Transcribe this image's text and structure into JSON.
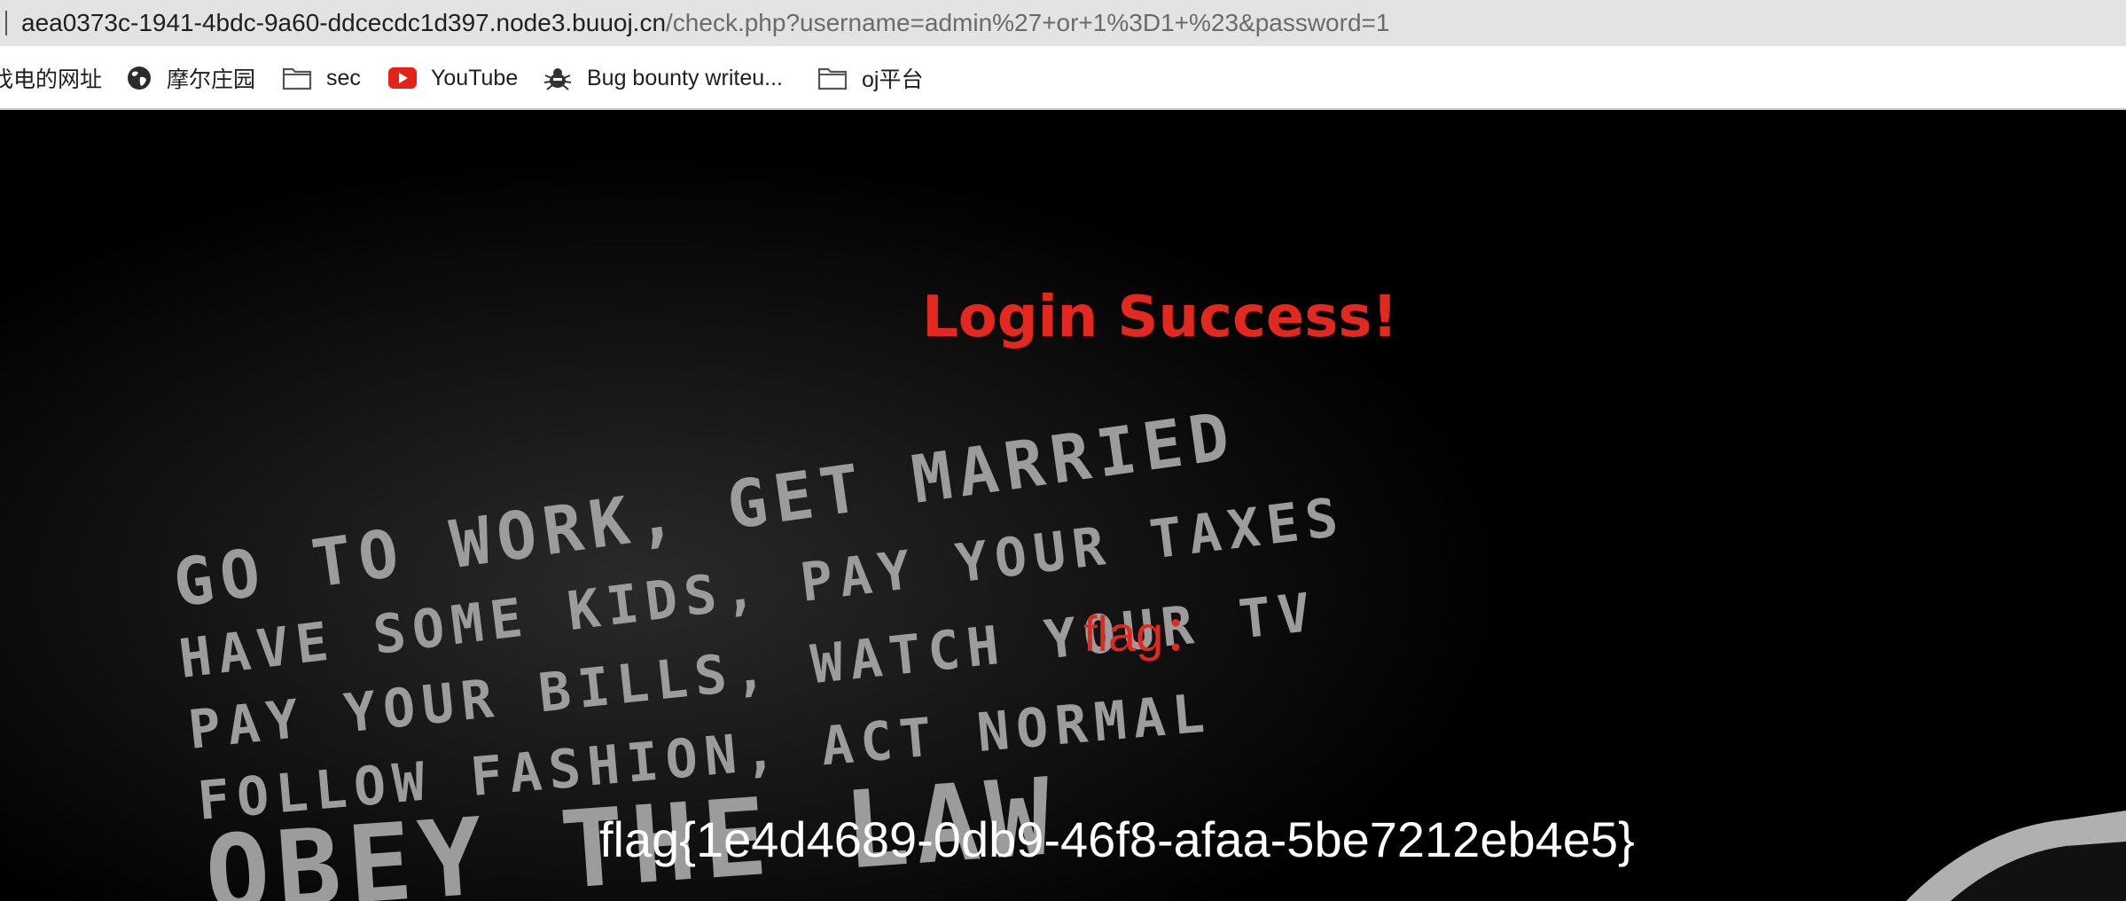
{
  "browser": {
    "url_host": "aea0373c-1941-4bdc-9a60-ddcecdc1d397.node3.buuoj.cn",
    "url_path": "/check.php?username=admin%27+or+1%3D1+%23&password=1",
    "bookmarks": [
      {
        "label": "找电的网址",
        "icon": "none"
      },
      {
        "label": "摩尔庄园",
        "icon": "globe-icon"
      },
      {
        "label": "sec",
        "icon": "folder-icon"
      },
      {
        "label": "YouTube",
        "icon": "youtube-icon"
      },
      {
        "label": "Bug bounty writeu...",
        "icon": "bug-icon"
      },
      {
        "label": "oj平台",
        "icon": "folder-icon"
      }
    ]
  },
  "page": {
    "heading": "Login Success!",
    "flag_label": "flag：",
    "flag_value": "flag{1e4d4689-0db9-46f8-afaa-5be7212eb4e5}",
    "background_text": [
      "GO TO WORK, GET MARRIED",
      "HAVE SOME KIDS, PAY YOUR TAXES",
      "PAY YOUR BILLS, WATCH YOUR TV",
      "FOLLOW FASHION, ACT NORMAL",
      "OBEY THE LAW"
    ]
  },
  "colors": {
    "heading": "#e3281f",
    "flag_label": "#e3281f",
    "flag_value": "#ffffff",
    "page_background": "#000000"
  }
}
